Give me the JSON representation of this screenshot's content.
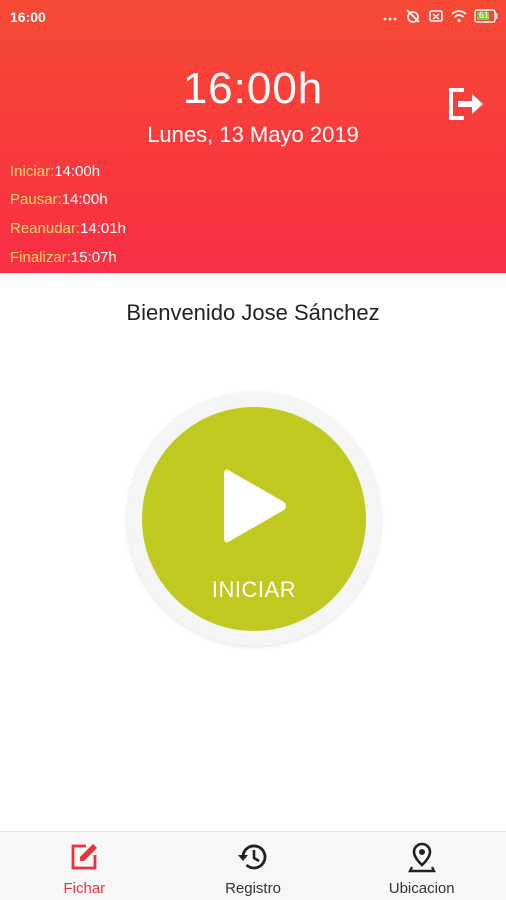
{
  "status_bar": {
    "time": "16:00",
    "battery": "61"
  },
  "header": {
    "clock": "16:00h",
    "date": "Lunes, 13 Mayo 2019",
    "log": [
      {
        "label": "Iniciar:",
        "value": "14:00h"
      },
      {
        "label": "Pausar:",
        "value": "14:00h"
      },
      {
        "label": "Reanudar:",
        "value": "14:01h"
      },
      {
        "label": "Finalizar:",
        "value": "15:07h"
      }
    ]
  },
  "welcome": "Bienvenido Jose Sánchez",
  "main_button": {
    "label": "INICIAR"
  },
  "nav": [
    {
      "label": "Fichar",
      "icon": "edit-icon",
      "active": true
    },
    {
      "label": "Registro",
      "icon": "history-icon",
      "active": false
    },
    {
      "label": "Ubicacion",
      "icon": "location-pin-icon",
      "active": false
    }
  ],
  "colors": {
    "accent": "#e8343d",
    "header": "#f83a3d",
    "button": "#c0c91f",
    "log_label": "#ffd36b"
  }
}
